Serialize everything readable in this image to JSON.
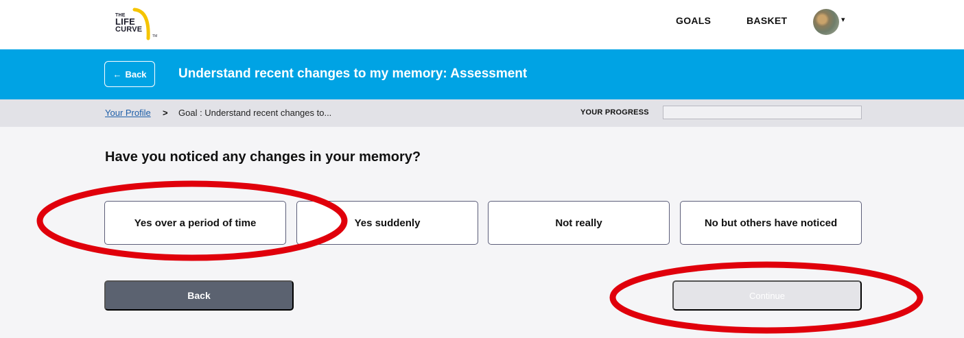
{
  "brand": {
    "logo_lines": [
      "THE",
      "LIFE",
      "CURVE"
    ],
    "logo_tm": "TM",
    "logo_accent": "#f5c400"
  },
  "nav": {
    "goals": "GOALS",
    "basket": "BASKET",
    "caret": "▾"
  },
  "header": {
    "back_arrow": "←",
    "back_label": "Back",
    "title": "Understand recent changes to my memory: Assessment",
    "color": "#00a3e4"
  },
  "breadcrumb": {
    "profile_link": "Your Profile",
    "separator": ">",
    "current": "Goal : Understand recent changes to..."
  },
  "progress": {
    "label": "YOUR PROGRESS",
    "value_fraction": 0
  },
  "question": {
    "text": "Have you noticed any changes in your memory?",
    "options": [
      "Yes over a period of time",
      "Yes suddenly",
      "Not really",
      "No but others have noticed"
    ]
  },
  "actions": {
    "back_label": "Back",
    "continue_label": "Continue",
    "continue_enabled": false
  },
  "annotations": {
    "color": "#e0000b"
  }
}
